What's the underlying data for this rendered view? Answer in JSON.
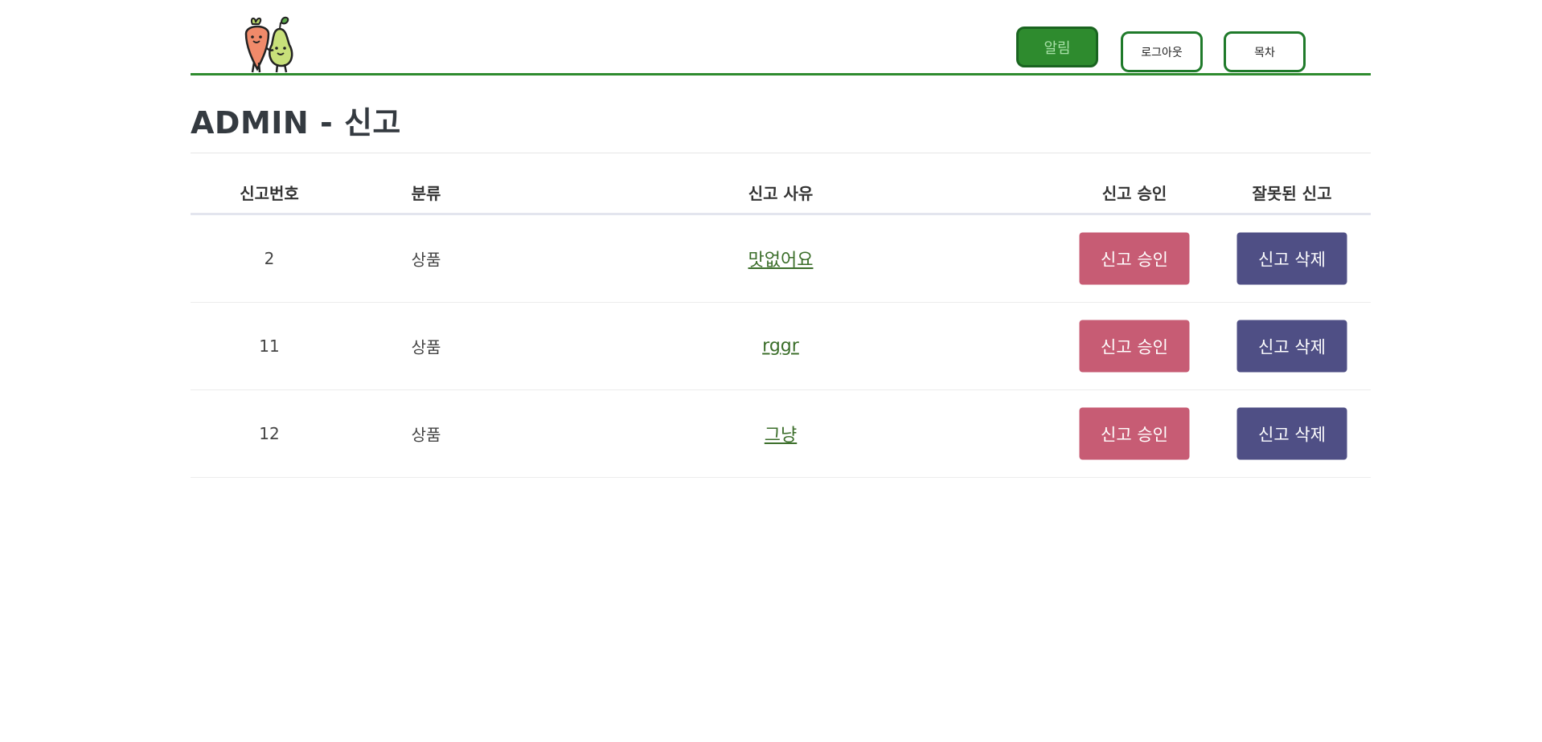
{
  "header": {
    "alarm_label": "알림",
    "logout_label": "로그아웃",
    "list_label": "목차"
  },
  "page": {
    "title": "ADMIN - 신고"
  },
  "table": {
    "columns": [
      "신고번호",
      "분류",
      "신고 사유",
      "신고 승인",
      "잘못된 신고"
    ],
    "rows": [
      {
        "id": "2",
        "category": "상품",
        "reason": "맛없어요",
        "approve_label": "신고 승인",
        "delete_label": "신고 삭제"
      },
      {
        "id": "11",
        "category": "상품",
        "reason": "rggr",
        "approve_label": "신고 승인",
        "delete_label": "신고 삭제"
      },
      {
        "id": "12",
        "category": "상품",
        "reason": "그냥",
        "approve_label": "신고 승인",
        "delete_label": "신고 삭제"
      }
    ]
  },
  "colors": {
    "accent_green": "#2e8b2e",
    "approve": "#c75c74",
    "delete": "#4f4f85"
  },
  "icons": {
    "logo": "carrot-pear-logo-icon"
  }
}
